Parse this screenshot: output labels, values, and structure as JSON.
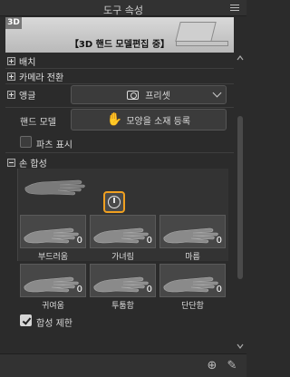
{
  "window": {
    "title": "도구 속성"
  },
  "banner": {
    "badge": "3D",
    "caption": "【3D 핸드 모델편집 중】"
  },
  "sections": {
    "placement": "배치",
    "camera": "카메라 전환",
    "angle": "앵글",
    "hand_model": "핸드 모델",
    "show_joints": "파츠 표시",
    "hand_pose": "손 합성"
  },
  "angle_dropdown": {
    "icon": "camera-icon",
    "value": "프리셋"
  },
  "hand_model_button": {
    "icon": "hand-icon",
    "label": "모양을 소재 등록"
  },
  "presets": [
    {
      "label": "부드러움",
      "count": "0"
    },
    {
      "label": "가녀림",
      "count": "0"
    },
    {
      "label": "마름",
      "count": "0"
    },
    {
      "label": "귀여움",
      "count": "0"
    },
    {
      "label": "투툼함",
      "count": "0"
    },
    {
      "label": "단단함",
      "count": "0"
    }
  ],
  "limit_checkbox": {
    "label": "합성 제한",
    "checked": true
  },
  "colors": {
    "accent": "#f0a020",
    "background": "#2b2b2b",
    "panel": "#3b3b3b"
  }
}
